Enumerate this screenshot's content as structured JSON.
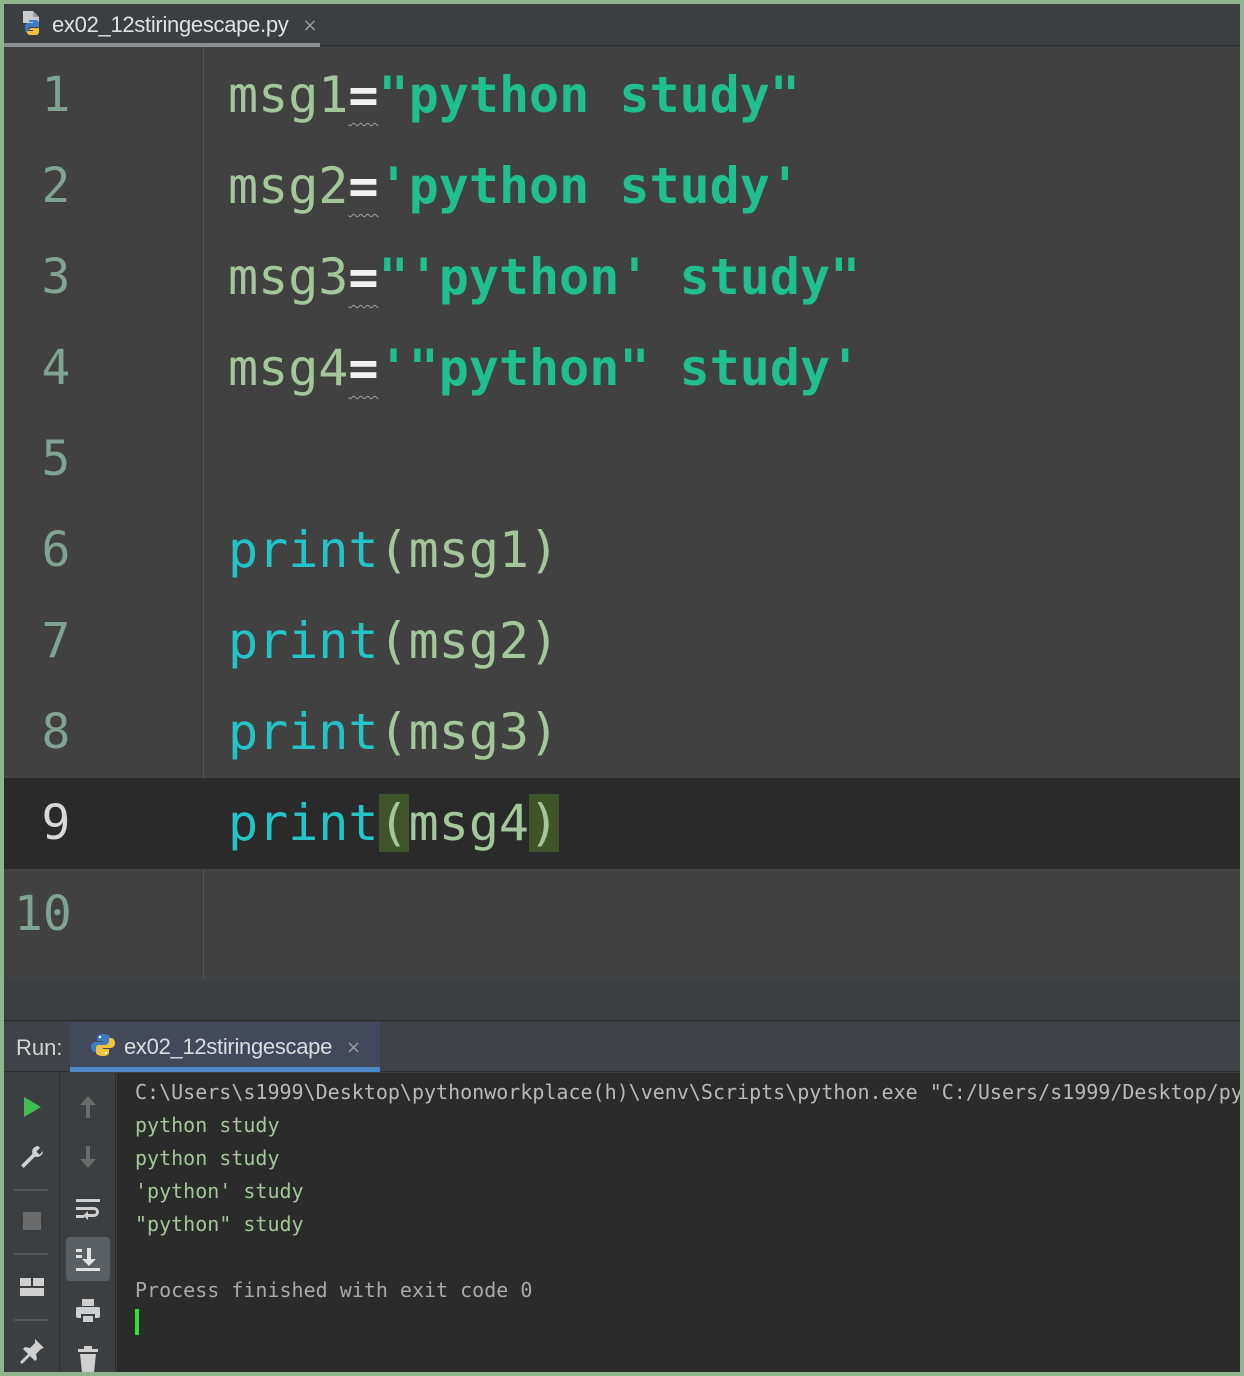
{
  "editor_tab": {
    "filename": "ex02_12stiringescape.py",
    "close": "×"
  },
  "editor": {
    "lines": [
      {
        "number": "1",
        "var": "msg1",
        "eq": "=",
        "str": "\"python study\""
      },
      {
        "number": "2",
        "var": "msg2",
        "eq": "=",
        "str": "'python study'"
      },
      {
        "number": "3",
        "var": "msg3",
        "eq": "=",
        "str": "\"'python' study\""
      },
      {
        "number": "4",
        "var": "msg4",
        "eq": "=",
        "str": "'\"python\" study'"
      },
      {
        "number": "5"
      },
      {
        "number": "6",
        "fn": "print",
        "open": "(",
        "arg": "msg1",
        "close": ")"
      },
      {
        "number": "7",
        "fn": "print",
        "open": "(",
        "arg": "msg2",
        "close": ")"
      },
      {
        "number": "8",
        "fn": "print",
        "open": "(",
        "arg": "msg3",
        "close": ")"
      },
      {
        "number": "9",
        "fn": "print",
        "open": "(",
        "arg": "msg4",
        "close": ")"
      },
      {
        "number": "10"
      }
    ],
    "current_line": 9
  },
  "run_panel": {
    "label": "Run:",
    "tab_name": "ex02_12stiringescape",
    "tab_close": "×",
    "console": {
      "command": "C:\\Users\\s1999\\Desktop\\pythonworkplace(h)\\venv\\Scripts\\python.exe \"C:/Users/s1999/Desktop/py",
      "output": [
        "python study",
        "python study",
        "'python' study",
        "\"python\" study"
      ],
      "process": "Process finished with exit code 0"
    }
  },
  "icons": {
    "left_strip": [
      "run-icon",
      "wrench-icon",
      "stop-icon",
      "layout-icon",
      "pin-icon"
    ],
    "right_strip": [
      "up-arrow-icon",
      "down-arrow-icon",
      "soft-wrap-icon",
      "scroll-to-end-icon",
      "print-icon",
      "trash-icon"
    ]
  },
  "colors": {
    "string": "#1fbf8f",
    "function": "#23c3c8",
    "variable": "#a3c79a",
    "bracket_highlight": "#40542a",
    "run_green": "#3dbf54",
    "accent_blue": "#4a88c7"
  }
}
